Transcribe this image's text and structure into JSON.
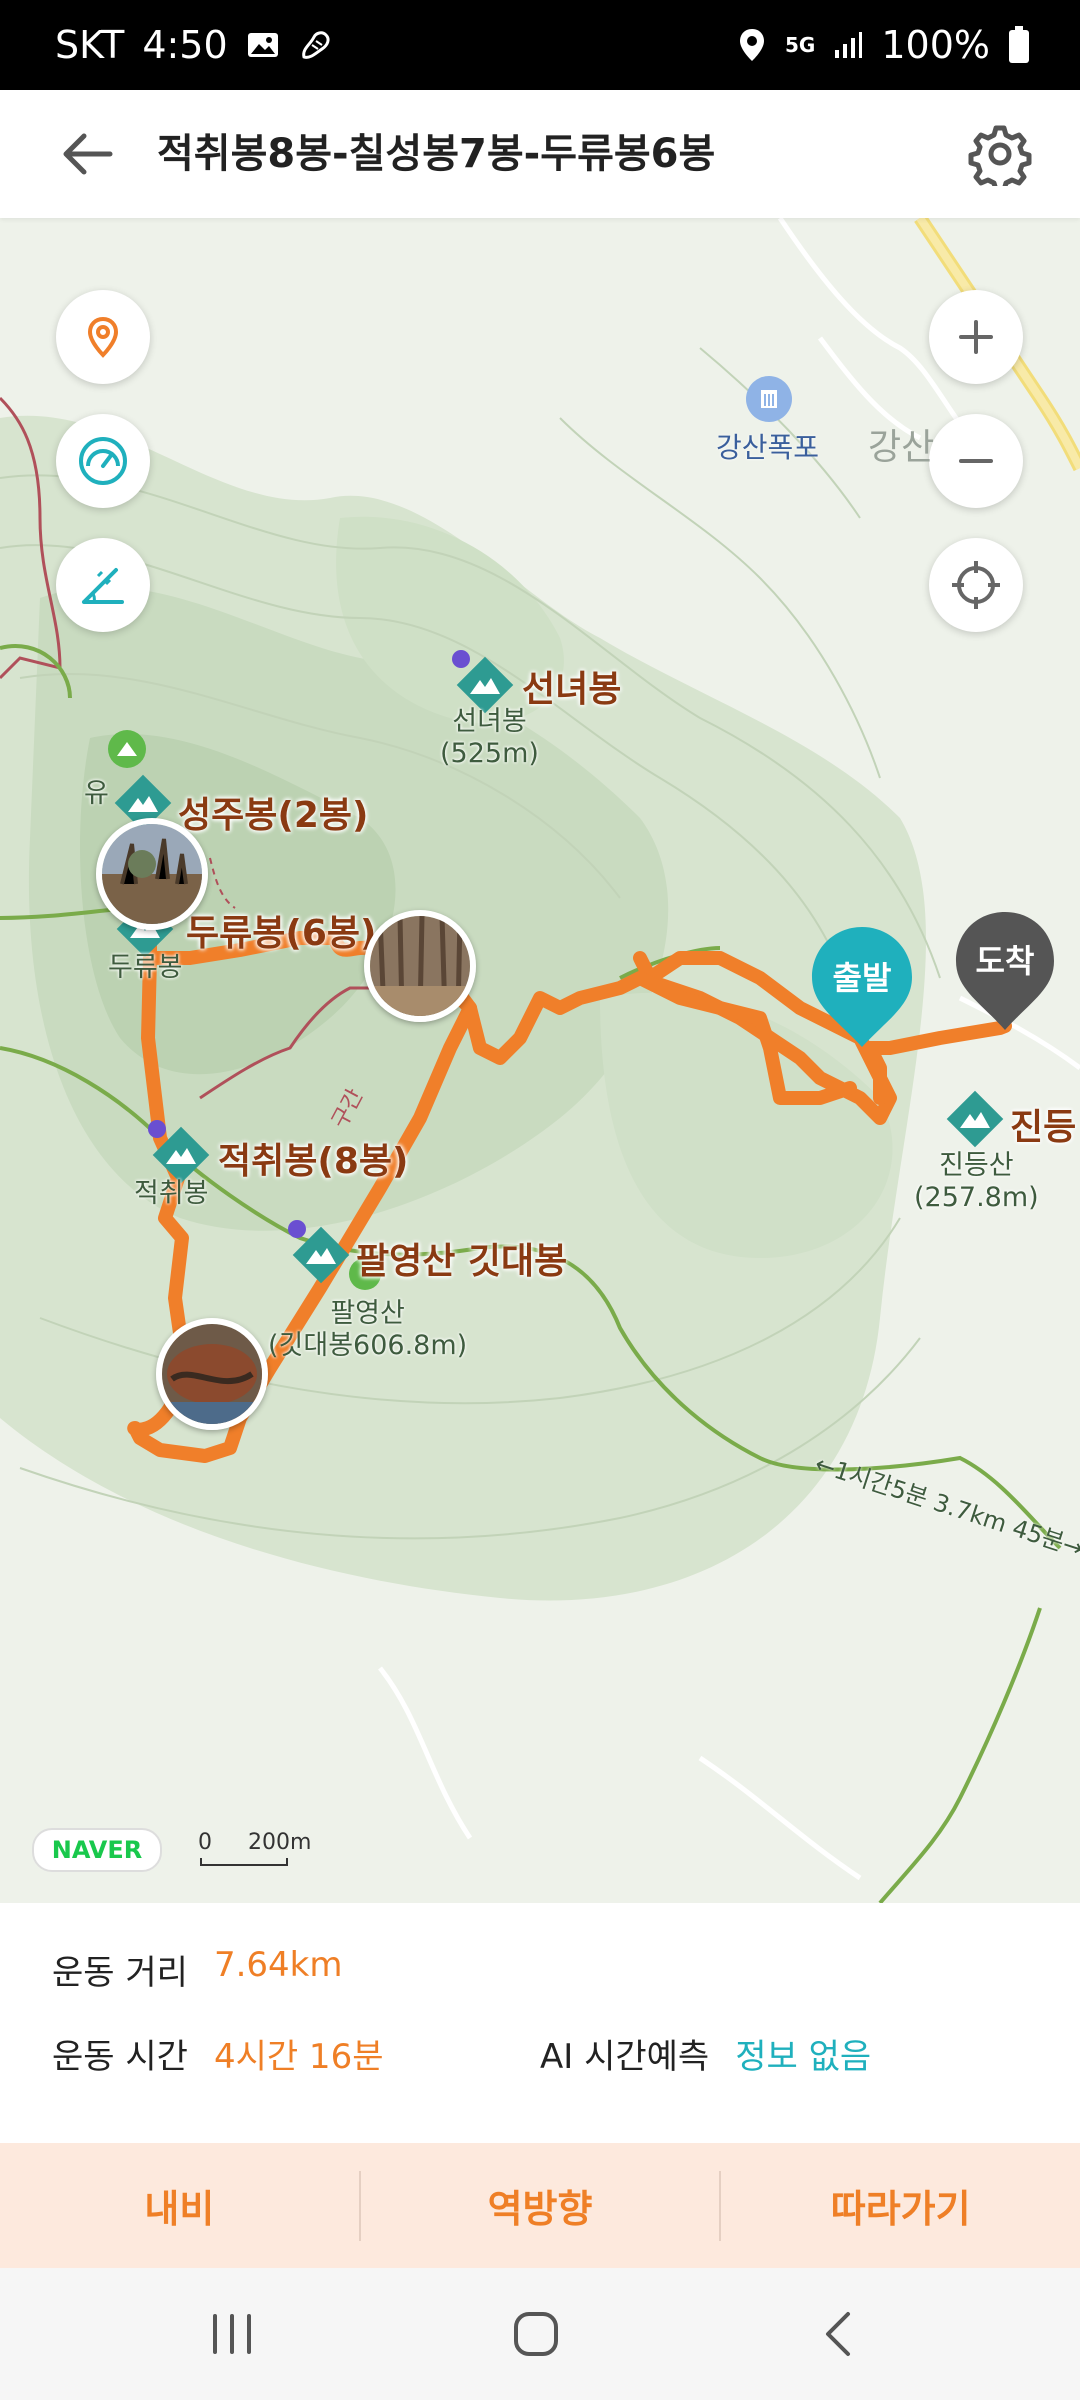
{
  "status_bar": {
    "carrier": "SKT",
    "time": "4:50",
    "network": "5G",
    "battery": "100%"
  },
  "header": {
    "title": "적취봉8봉-칠성봉7봉-두류봉6봉"
  },
  "map": {
    "poi": {
      "falls": "강산폭포",
      "gangsan_partial": "강산"
    },
    "peaks": {
      "seonnyeo_name": "선녀봉",
      "seonnyeo_sub1": "선녀봉",
      "seonnyeo_sub2": "(525m)",
      "seongju_name": "성주봉(2봉)",
      "yu_partial": "유",
      "duryu_name": "두류봉(6봉)",
      "duryu_sub": "두류봉",
      "jeokchwi_name": "적취봉(8봉)",
      "jeokchwi_sub": "적취봉",
      "palyeong_name": "팔영산 깃대봉",
      "palyeong_sub1": "팔영산",
      "palyeong_sub2": "(깃대봉606.8m)",
      "jindeung_name": "진등",
      "jindeung_sub1": "진등산",
      "jindeung_sub2": "(257.8m)"
    },
    "markers": {
      "start": "출발",
      "end": "도착"
    },
    "trail_text": "←1시간5분 3.7km 45분→",
    "section_text": "구간",
    "naver": "NAVER",
    "scale": {
      "zero": "0",
      "distance": "200m"
    }
  },
  "info": {
    "distance_label": "운동 거리",
    "distance_value": "7.64km",
    "time_label": "운동 시간",
    "time_value": "4시간 16분",
    "ai_label": "AI 시간예측",
    "ai_value": "정보 없음"
  },
  "actions": {
    "navigate": "내비",
    "reverse": "역방향",
    "follow": "따라가기"
  },
  "colors": {
    "route": "#f07f2a",
    "accent": "#ef7f26",
    "teal": "#1fb0bd",
    "map_bg": "#e9efe4"
  }
}
